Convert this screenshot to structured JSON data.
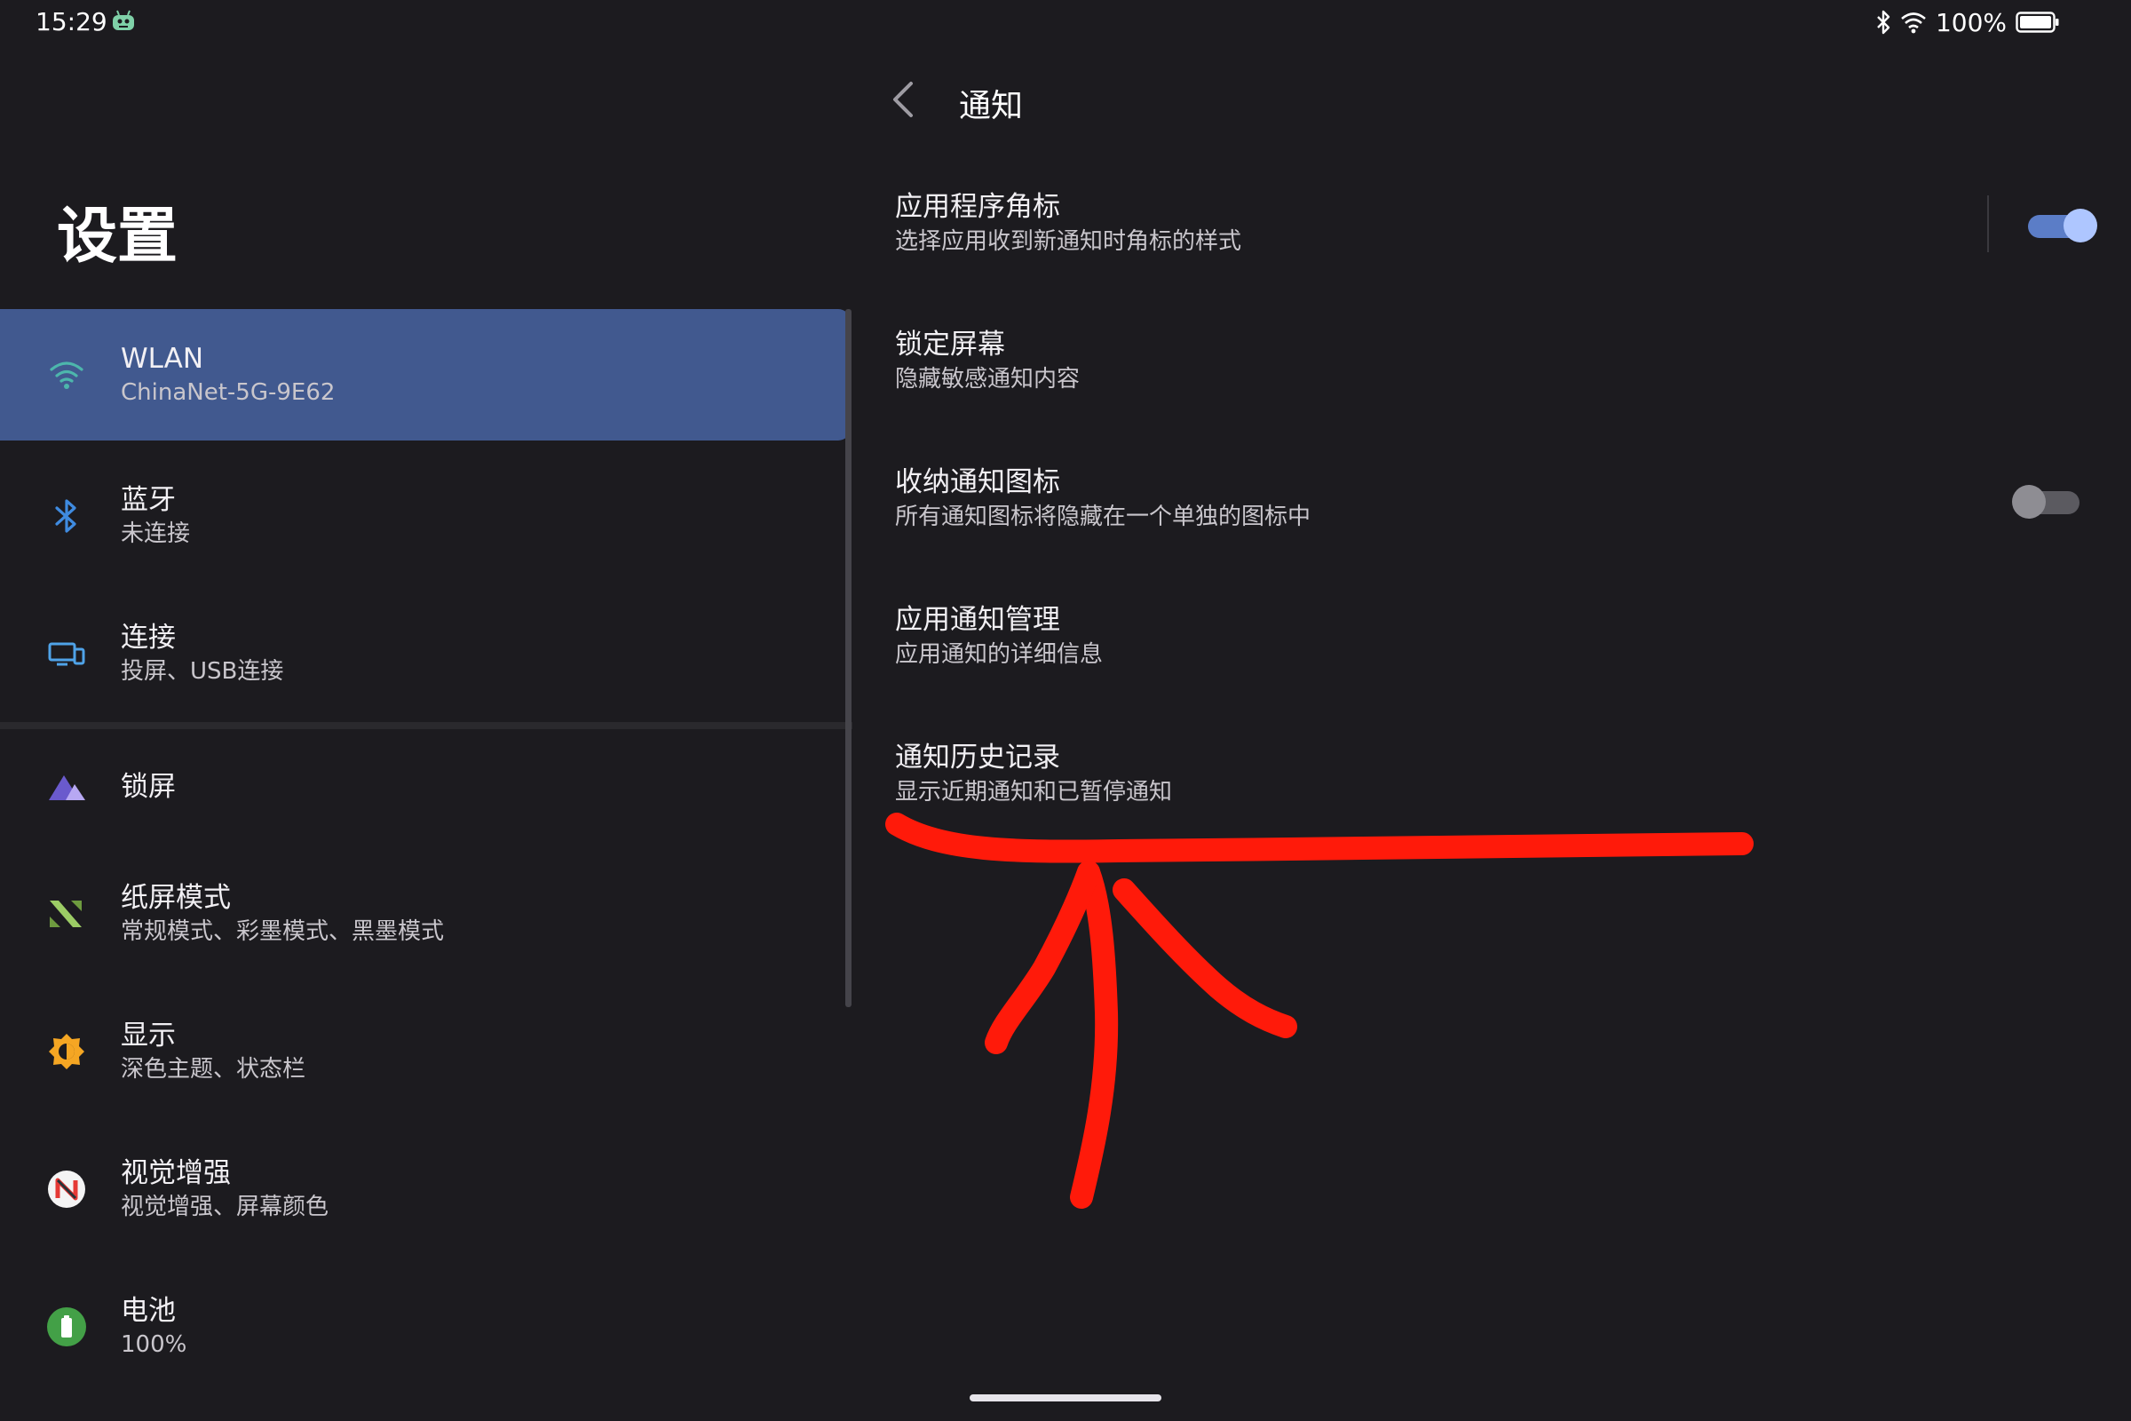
{
  "status_bar": {
    "time": "15:29",
    "app_icon": "android-robot-icon",
    "bluetooth_icon": "bluetooth-icon",
    "wifi_icon": "wifi-icon",
    "battery_text": "100%",
    "battery_icon": "battery-full-icon"
  },
  "left_pane": {
    "title": "设置",
    "items": [
      {
        "title": "WLAN",
        "subtitle": "ChinaNet-5G-9E62",
        "icon": "wifi-icon",
        "icon_color": "#4db6ac",
        "selected": true
      },
      {
        "title": "蓝牙",
        "subtitle": "未连接",
        "icon": "bluetooth-icon",
        "icon_color": "#3f8be0"
      },
      {
        "title": "连接",
        "subtitle": "投屏、USB连接",
        "icon": "devices-icon",
        "icon_color": "#4fa3e8"
      },
      {
        "title": "锁屏",
        "subtitle": "",
        "icon": "lock-screen-triangle-icon",
        "icon_color": "#8e7be0"
      },
      {
        "title": "纸屏模式",
        "subtitle": "常规模式、彩墨模式、黑墨模式",
        "icon": "paper-mode-icon",
        "icon_color": "#9ccc65"
      },
      {
        "title": "显示",
        "subtitle": "深色主题、状态栏",
        "icon": "brightness-icon",
        "icon_color": "#f5a623"
      },
      {
        "title": "视觉增强",
        "subtitle": "视觉增强、屏幕颜色",
        "icon": "vision-enhance-icon",
        "icon_color": "#e53935"
      },
      {
        "title": "电池",
        "subtitle": "100%",
        "icon": "battery-icon",
        "icon_color": "#43a047"
      }
    ]
  },
  "right_pane": {
    "back_icon": "back-arrow-icon",
    "title": "通知",
    "prefs": [
      {
        "title": "应用程序角标",
        "subtitle": "选择应用收到新通知时角标的样式",
        "toggle": "on"
      },
      {
        "title": "锁定屏幕",
        "subtitle": "隐藏敏感通知内容"
      },
      {
        "title": "收纳通知图标",
        "subtitle": "所有通知图标将隐藏在一个单独的图标中",
        "toggle": "off"
      },
      {
        "title": "应用通知管理",
        "subtitle": "应用通知的详细信息"
      },
      {
        "title": "通知历史记录",
        "subtitle": "显示近期通知和已暂停通知"
      }
    ]
  },
  "annotation": {
    "type": "hand-drawn-underline-and-arrow",
    "color": "#ff1a0a",
    "points_to": "通知历史记录"
  },
  "colors": {
    "background": "#1c1b1f",
    "selected_item": "#41598f",
    "toggle_on_track": "#5b7dc7",
    "toggle_on_thumb": "#aec6ff"
  }
}
